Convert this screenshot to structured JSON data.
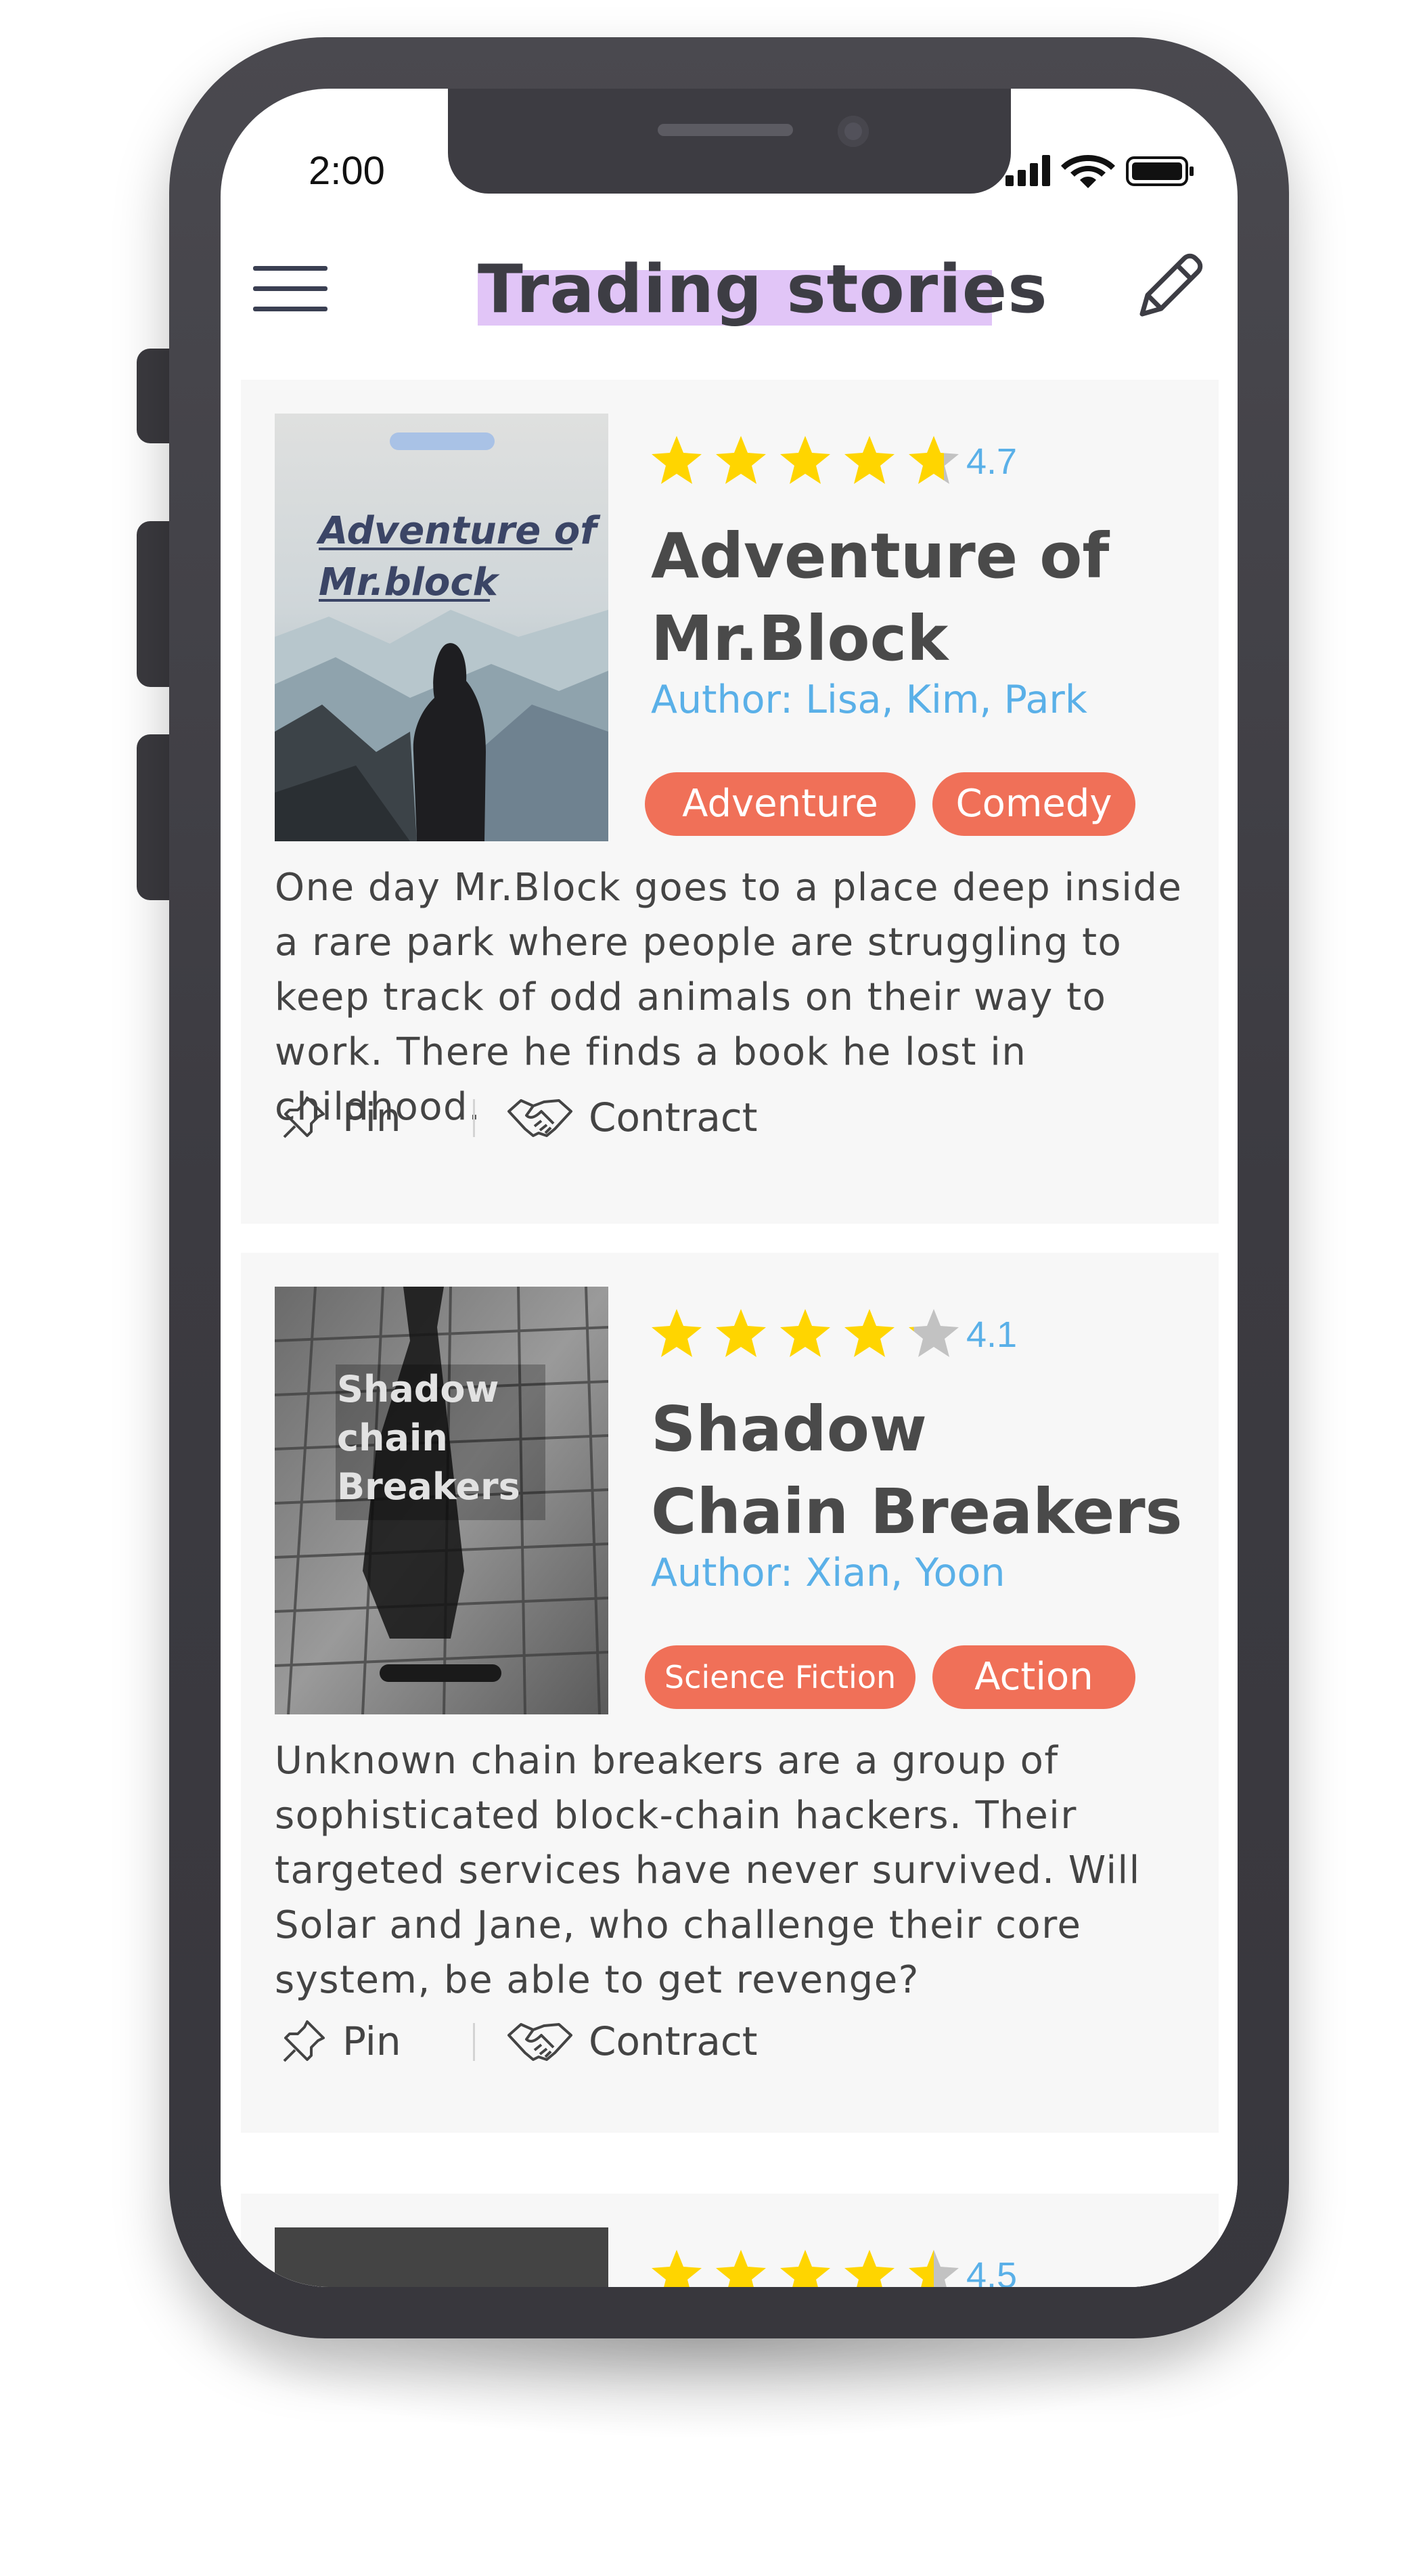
{
  "status_bar": {
    "time": "2:00"
  },
  "header": {
    "title": "Trading stories"
  },
  "stories": [
    {
      "cover_text": "Adventure of Mr.block",
      "cover_line1": "Adventure of",
      "cover_line2": "Mr.block",
      "rating": "4.7",
      "rating_value": 4.7,
      "title_line1": "Adventure of",
      "title_line2": "Mr.Block",
      "author": "Author: Lisa, Kim, Park",
      "tags": [
        "Adventure",
        "Comedy"
      ],
      "description": "One day Mr.Block goes to a place deep inside a rare park where people are struggling to keep track of odd animals on their way to work. There he finds a book he lost in childhood.",
      "pin_label": "Pin",
      "contract_label": "Contract"
    },
    {
      "cover_line1": "Shadow",
      "cover_line2": "chain",
      "cover_line3": "Breakers",
      "rating": "4.1",
      "rating_value": 4.1,
      "title_line1": "Shadow",
      "title_line2": "Chain Breakers",
      "author": "Author: Xian, Yoon",
      "tags": [
        "Science Fiction",
        "Action"
      ],
      "description": "Unknown chain breakers are a group of sophisticated block-chain hackers. Their targeted services have never survived. Will Solar and Jane, who challenge their core system, be able to get revenge?",
      "pin_label": "Pin",
      "contract_label": "Contract"
    },
    {
      "rating": "4.5",
      "rating_value": 4.5
    }
  ],
  "colors": {
    "star": "#ffd500",
    "star_empty": "#c2c2c2",
    "tag": "#f07058",
    "link": "#5ab0e8",
    "title_highlight": "#d9b6f5"
  },
  "icons": [
    "menu-icon",
    "edit-pencil-icon",
    "star-icon",
    "pin-icon",
    "handshake-icon",
    "signal-icon",
    "wifi-icon",
    "battery-icon"
  ]
}
